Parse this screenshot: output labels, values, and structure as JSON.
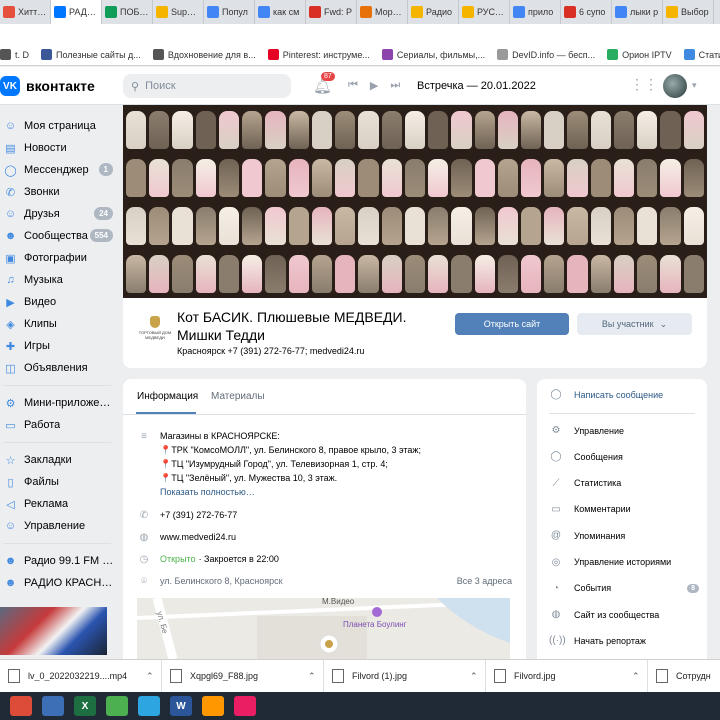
{
  "browser": {
    "tabs": [
      {
        "title": "Хитти 5",
        "color": "#e5503d"
      },
      {
        "title": "РАДИО",
        "color": "#0077ff"
      },
      {
        "title": "ПОБЕД",
        "color": "#0f9d58"
      },
      {
        "title": "Supu D",
        "color": "#f4b400"
      },
      {
        "title": "Попул",
        "color": "#4285f4"
      },
      {
        "title": "как см",
        "color": "#4285f4"
      },
      {
        "title": "Fwd: P",
        "color": "#d93025"
      },
      {
        "title": "Морфо",
        "color": "#e8710a"
      },
      {
        "title": "Радио",
        "color": "#f4b400"
      },
      {
        "title": "РУСАЛ",
        "color": "#f4b400"
      },
      {
        "title": "прило",
        "color": "#4285f4"
      },
      {
        "title": "6 супо",
        "color": "#d93025"
      },
      {
        "title": "лыки р",
        "color": "#4285f4"
      },
      {
        "title": "Выбор",
        "color": "#f4b400"
      }
    ],
    "bookmarks": [
      {
        "label": "t. D",
        "color": "#555"
      },
      {
        "label": "Полезные сайты д...",
        "color": "#3b5998"
      },
      {
        "label": "Вдохновение для в...",
        "color": "#555"
      },
      {
        "label": "Pinterest: инструме...",
        "color": "#e60023"
      },
      {
        "label": "Сериалы, фильмы,...",
        "color": "#8e44ad"
      },
      {
        "label": "DevID.info — бесп...",
        "color": "#999"
      },
      {
        "label": "Орион IPTV",
        "color": "#27ae60"
      },
      {
        "label": "Статистика сообщ...",
        "color": "#3f8ae0"
      }
    ]
  },
  "header": {
    "logo_text": "вконтакте",
    "logo_mark": "VK",
    "search_placeholder": "Поиск",
    "notifications_count": "87",
    "now_playing": "Встречка — 20.01.2022"
  },
  "nav": {
    "items": [
      {
        "label": "Моя страница",
        "icon": "user-icon",
        "glyph": "☺"
      },
      {
        "label": "Новости",
        "icon": "news-icon",
        "glyph": "▤"
      },
      {
        "label": "Мессенджер",
        "icon": "chat-icon",
        "glyph": "◯",
        "badge": "1"
      },
      {
        "label": "Звонки",
        "icon": "phone-icon",
        "glyph": "✆"
      },
      {
        "label": "Друзья",
        "icon": "friends-icon",
        "glyph": "☺",
        "badge": "24"
      },
      {
        "label": "Сообщества",
        "icon": "groups-icon",
        "glyph": "☻",
        "badge": "554"
      },
      {
        "label": "Фотографии",
        "icon": "photo-icon",
        "glyph": "▣"
      },
      {
        "label": "Музыка",
        "icon": "music-icon",
        "glyph": "♫"
      },
      {
        "label": "Видео",
        "icon": "video-icon",
        "glyph": "▶"
      },
      {
        "label": "Клипы",
        "icon": "clips-icon",
        "glyph": "◈"
      },
      {
        "label": "Игры",
        "icon": "games-icon",
        "glyph": "✚"
      },
      {
        "label": "Объявления",
        "icon": "ads-icon",
        "glyph": "◫"
      }
    ],
    "items2": [
      {
        "label": "Мини-приложения",
        "icon": "apps-icon",
        "glyph": "⚙"
      },
      {
        "label": "Работа",
        "icon": "work-icon",
        "glyph": "▭"
      }
    ],
    "items3": [
      {
        "label": "Закладки",
        "icon": "star-icon",
        "glyph": "☆"
      },
      {
        "label": "Файлы",
        "icon": "file-icon",
        "glyph": "▯"
      },
      {
        "label": "Реклама",
        "icon": "megaphone-icon",
        "glyph": "◁"
      },
      {
        "label": "Управление",
        "icon": "manage-icon",
        "glyph": "☺"
      }
    ],
    "items4": [
      {
        "label": "Радио 99.1 FM (г. ...",
        "icon": "group-icon",
        "glyph": "☻"
      },
      {
        "label": "РАДИО КРАСНОЯ...",
        "icon": "group-icon",
        "glyph": "☻"
      }
    ]
  },
  "group": {
    "logo_text": "ТОРГОВЫЙ ДОМ МЕДВЕДИ",
    "name": "Кот БАСИК. Плюшевые МЕДВЕДИ. Мишки Тедди",
    "subtitle": "Красноярск +7 (391) 272-76-77; medvedi24.ru",
    "open_site_label": "Открыть сайт",
    "member_label": "Вы участник"
  },
  "info": {
    "tab_info": "Информация",
    "tab_materials": "Материалы",
    "description_lines": [
      "Магазины в КРАСНОЯРСКЕ:",
      "📍ТРК \"КомсоМОЛЛ\", ул. Белинского 8, правое крыло, 3 этаж;",
      "📍ТЦ \"Изумрудный Город\", ул. Телевизорная 1, стр. 4;",
      "📍ТЦ \"Зелёный\", ул. Мужества 10, 3 этаж."
    ],
    "show_more": "Показать полностью…",
    "phone": "+7 (391) 272-76-77",
    "site": "www.medvedi24.ru",
    "open_status": "Открыто",
    "closes": "· Закроется в 22:00",
    "address": "ул. Белинского 8, Красноярск",
    "all_addresses": "Все 3 адреса",
    "map_labels": {
      "store": "М.Видео",
      "bowling": "Планета Боулинг",
      "street": "ул. Бе"
    }
  },
  "right_menu": [
    {
      "label": "Написать сообщение",
      "icon": "message-icon",
      "glyph": "◯"
    },
    {
      "label": "Управление",
      "icon": "gear-icon",
      "glyph": "⚙"
    },
    {
      "label": "Сообщения",
      "icon": "messages-icon",
      "glyph": "◯"
    },
    {
      "label": "Статистика",
      "icon": "stats-icon",
      "glyph": "⟋"
    },
    {
      "label": "Комментарии",
      "icon": "comments-icon",
      "glyph": "▭"
    },
    {
      "label": "Упоминания",
      "icon": "mention-icon",
      "glyph": "@"
    },
    {
      "label": "Управление историями",
      "icon": "stories-icon",
      "glyph": "◎"
    },
    {
      "label": "События",
      "icon": "events-icon",
      "glyph": "◔",
      "badge": "8"
    },
    {
      "label": "Сайт из сообщества",
      "icon": "globe-icon",
      "glyph": "◍"
    },
    {
      "label": "Начать репортаж",
      "icon": "broadcast-icon",
      "glyph": "((·))"
    }
  ],
  "downloads": [
    {
      "name": "lv_0_2022032219....mp4"
    },
    {
      "name": "Xqpgl69_F88.jpg"
    },
    {
      "name": "Filvord (1).jpg"
    },
    {
      "name": "Filvord.jpg"
    },
    {
      "name": "Сотрудн"
    }
  ],
  "taskbar": [
    {
      "label": "",
      "icon": "chrome-icon",
      "color": "#dd4b39"
    },
    {
      "label": "",
      "icon": "app-icon",
      "color": "#3d6fb6"
    },
    {
      "label": "X",
      "icon": "excel-icon",
      "color": "#1d6f42"
    },
    {
      "label": "",
      "icon": "clover-icon",
      "color": "#4caf50"
    },
    {
      "label": "",
      "icon": "telegram-icon",
      "color": "#2ca5e0"
    },
    {
      "label": "W",
      "icon": "word-icon",
      "color": "#2b579a"
    },
    {
      "label": "",
      "icon": "paint-icon",
      "color": "#ff9800"
    },
    {
      "label": "",
      "icon": "media-icon",
      "color": "#e91e63"
    }
  ]
}
